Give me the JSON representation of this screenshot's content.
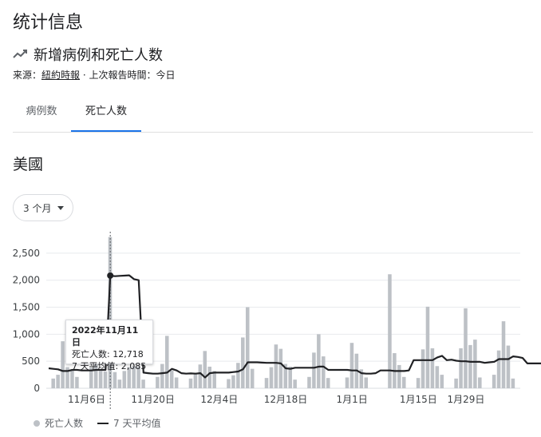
{
  "page": {
    "title": "统计信息",
    "section_title": "新增病例和死亡人数",
    "source_label": "来源：",
    "source_name": "紐約時報",
    "updated_text": "· 上次報告時間：今日",
    "tabs": [
      {
        "label": "病例数",
        "active": false
      },
      {
        "label": "死亡人数",
        "active": true
      }
    ],
    "region": "美國",
    "range_select": "3 个月"
  },
  "colors": {
    "bar": "#bdc1c6",
    "line": "#202124",
    "grid": "#e8eaed",
    "tab_accent": "#1a73e8"
  },
  "tooltip": {
    "date": "2022年11月11日",
    "deaths_line": "死亡人数: 12,718",
    "avg_line": "7 天平均值: 2,085"
  },
  "legend": {
    "bars": "死亡人数",
    "line": "7 天平均值"
  },
  "chart_data": {
    "type": "bar",
    "title": "",
    "xlabel": "",
    "ylabel": "",
    "ylim": [
      0,
      2800
    ],
    "yticks": [
      0,
      500,
      1000,
      1500,
      2000,
      2500
    ],
    "ytick_labels": [
      "0",
      "500",
      "1,000",
      "1,500",
      "2,000",
      "2,500"
    ],
    "xtick_labels": [
      {
        "label": "11月6日",
        "index": 8
      },
      {
        "label": "11月20日",
        "index": 22
      },
      {
        "label": "12月4日",
        "index": 36
      },
      {
        "label": "12月18日",
        "index": 50
      },
      {
        "label": "1月1日",
        "index": 64
      },
      {
        "label": "1月15日",
        "index": 78
      },
      {
        "label": "1月29日",
        "index": 92
      }
    ],
    "start_date": "2022-10-29",
    "highlight_index": 13,
    "highlight_value": 12718,
    "series": [
      {
        "name": "死亡人数",
        "type": "bar",
        "values": [
          0,
          180,
          250,
          870,
          390,
          350,
          210,
          0,
          0,
          380,
          450,
          320,
          310,
          12718,
          300,
          160,
          320,
          390,
          410,
          400,
          160,
          0,
          0,
          210,
          450,
          970,
          330,
          200,
          0,
          0,
          180,
          260,
          440,
          690,
          400,
          320,
          0,
          0,
          170,
          240,
          470,
          940,
          1500,
          360,
          0,
          0,
          190,
          390,
          810,
          730,
          450,
          400,
          160,
          0,
          0,
          210,
          660,
          1000,
          590,
          190,
          0,
          0,
          0,
          200,
          840,
          640,
          350,
          200,
          0,
          0,
          0,
          0,
          2110,
          650,
          430,
          210,
          0,
          0,
          190,
          720,
          1510,
          740,
          410,
          250,
          0,
          0,
          180,
          740,
          1480,
          800,
          900,
          200,
          0,
          0,
          250,
          700,
          1240,
          790,
          180,
          0
        ]
      },
      {
        "name": "7 天平均值",
        "type": "line",
        "values": [
          370,
          360,
          350,
          320,
          320,
          340,
          340,
          330,
          330,
          330,
          340,
          340,
          340,
          2085,
          2075,
          2080,
          2085,
          2090,
          2020,
          2000,
          290,
          280,
          270,
          270,
          280,
          290,
          360,
          330,
          280,
          270,
          275,
          270,
          280,
          200,
          280,
          290,
          290,
          290,
          290,
          300,
          310,
          350,
          480,
          480,
          480,
          475,
          470,
          470,
          470,
          460,
          370,
          360,
          380,
          380,
          380,
          380,
          380,
          400,
          400,
          340,
          340,
          340,
          340,
          340,
          330,
          330,
          280,
          270,
          270,
          280,
          330,
          330,
          330,
          320,
          320,
          320,
          330,
          520,
          520,
          520,
          520,
          520,
          570,
          600,
          520,
          530,
          510,
          500,
          500,
          490,
          490,
          490,
          470,
          480,
          490,
          540,
          540,
          540,
          590,
          580,
          560,
          460,
          460,
          460,
          460
        ]
      }
    ]
  }
}
